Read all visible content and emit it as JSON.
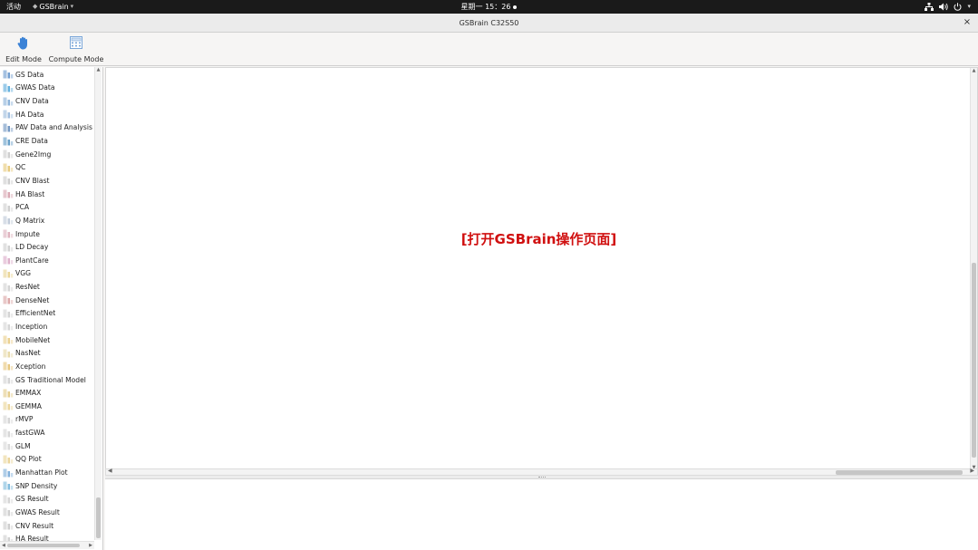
{
  "topbar": {
    "activities": "活动",
    "app_name": "GSBrain",
    "clock": "星期一 15：26",
    "icons": [
      "network-icon",
      "volume-icon",
      "power-icon"
    ]
  },
  "window": {
    "title": "GSBrain C32S50",
    "close_label": "×"
  },
  "toolbar": {
    "edit_mode": "Edit Mode",
    "compute_mode": "Compute Mode"
  },
  "sidebar": {
    "items": [
      {
        "label": "GS Data",
        "icon": "gs-data-icon",
        "color": "#5b8ec9"
      },
      {
        "label": "GWAS Data",
        "icon": "gwas-data-icon",
        "color": "#4aa3d8"
      },
      {
        "label": "CNV Data",
        "icon": "cnv-data-icon",
        "color": "#7aa7d4"
      },
      {
        "label": "HA Data",
        "icon": "ha-data-icon",
        "color": "#8fb3d9"
      },
      {
        "label": "PAV Data and Analysis",
        "icon": "pav-data-icon",
        "color": "#5d86b8"
      },
      {
        "label": "CRE Data",
        "icon": "cre-data-icon",
        "color": "#4f8fc0"
      },
      {
        "label": "Gene2Img",
        "icon": "gene2img-icon",
        "color": "#c7c7c7"
      },
      {
        "label": "QC",
        "icon": "qc-icon",
        "color": "#e3c26a"
      },
      {
        "label": "CNV Blast",
        "icon": "cnv-blast-icon",
        "color": "#c5c5c5"
      },
      {
        "label": "HA Blast",
        "icon": "ha-blast-icon",
        "color": "#d39aa7"
      },
      {
        "label": "PCA",
        "icon": "pca-icon",
        "color": "#c8c8c8"
      },
      {
        "label": "Q Matrix",
        "icon": "q-matrix-icon",
        "color": "#b7c3d3"
      },
      {
        "label": "Impute",
        "icon": "impute-icon",
        "color": "#d9a7b4"
      },
      {
        "label": "LD Decay",
        "icon": "ld-decay-icon",
        "color": "#c9c9c9"
      },
      {
        "label": "PlantCare",
        "icon": "plantcare-icon",
        "color": "#d8a3c2"
      },
      {
        "label": "VGG",
        "icon": "vgg-icon",
        "color": "#e6cf86"
      },
      {
        "label": "ResNet",
        "icon": "resnet-icon",
        "color": "#cccccc"
      },
      {
        "label": "DenseNet",
        "icon": "densenet-icon",
        "color": "#d79a9a"
      },
      {
        "label": "EfficientNet",
        "icon": "efficientnet-icon",
        "color": "#cdcdcd"
      },
      {
        "label": "Inception",
        "icon": "inception-icon",
        "color": "#cfcfcf"
      },
      {
        "label": "MobileNet",
        "icon": "mobilenet-icon",
        "color": "#e8c97e"
      },
      {
        "label": "NasNet",
        "icon": "nasnet-icon",
        "color": "#e4d39a"
      },
      {
        "label": "Xception",
        "icon": "xception-icon",
        "color": "#e3be6b"
      },
      {
        "label": "GS Traditional Model",
        "icon": "gs-traditional-model-icon",
        "color": "#cccccc"
      },
      {
        "label": "EMMAX",
        "icon": "emmax-icon",
        "color": "#e0c57a"
      },
      {
        "label": "GEMMA",
        "icon": "gemma-icon",
        "color": "#e7cf8b"
      },
      {
        "label": "rMVP",
        "icon": "rmvp-icon",
        "color": "#cfcfcf"
      },
      {
        "label": "fastGWA",
        "icon": "fastgwa-icon",
        "color": "#d0d0d0"
      },
      {
        "label": "GLM",
        "icon": "glm-icon",
        "color": "#d3d3d3"
      },
      {
        "label": "QQ Plot",
        "icon": "qq-plot-icon",
        "color": "#e7cf8b"
      },
      {
        "label": "Manhattan Plot",
        "icon": "manhattan-plot-icon",
        "color": "#6fa5d6"
      },
      {
        "label": "SNP Density",
        "icon": "snp-density-icon",
        "color": "#6fb2d8"
      },
      {
        "label": "GS Result",
        "icon": "gs-result-icon",
        "color": "#cfcfcf"
      },
      {
        "label": "GWAS Result",
        "icon": "gwas-result-icon",
        "color": "#c8c8c8"
      },
      {
        "label": "CNV Result",
        "icon": "cnv-result-icon",
        "color": "#c6c6c6"
      },
      {
        "label": "HA Result",
        "icon": "ha-result-icon",
        "color": "#c9c9c9"
      }
    ]
  },
  "main": {
    "message": "[打开GSBrain操作页面]",
    "message_color": "#d01010"
  }
}
